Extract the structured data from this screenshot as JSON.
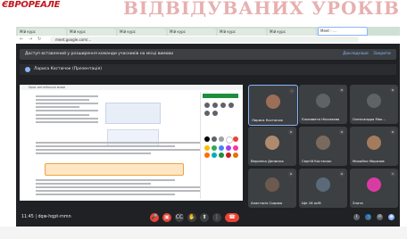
{
  "banner": {
    "logo_text": "ЄВРОРЕАЛЕ",
    "title": "ВІДВІДУВАНИХ УРОКІВ"
  },
  "browser": {
    "tabs": [
      "Мій курс",
      "Мій курс",
      "Мій курс",
      "Мій курс",
      "Мій курс",
      "Мій курс",
      "Meet - ..."
    ],
    "url": "meet.google.com/..."
  },
  "meet": {
    "info_text": "Доступ вставлений у розширення команди учасників на місці вимови",
    "info_links": [
      "Докладніше",
      "Закрити"
    ],
    "presenting_text": "Лариса Костючок (Презентація)",
    "doc_title": "Урок англійської мови",
    "tiles": [
      {
        "name": "Лариса Костючок",
        "color": "#9c6f58",
        "mic": "•"
      },
      {
        "name": "Єлизавета Ніколаєва",
        "color": "#5f6368",
        "mic": "⚙"
      },
      {
        "name": "Олександра Мак...",
        "color": "#5f6368",
        "mic": "⚙"
      },
      {
        "name": "Вероніка Денисюк",
        "color": "#b08a6e",
        "mic": "⚙"
      },
      {
        "name": "Сергій Костючок",
        "color": "#7a6a5e",
        "mic": "⚙"
      },
      {
        "name": "Михайло Морозов",
        "color": "#a47b5e",
        "mic": "⚙"
      },
      {
        "name": "Анастасія Сирова",
        "color": "#6d5a4f",
        "mic": "⚙"
      },
      {
        "name": "Ще 16 осіб",
        "color": "#5a6a7a",
        "mic": "⚙"
      },
      {
        "name": "Злата",
        "color": "#d93ba3",
        "mic": "З"
      }
    ],
    "time": "11:45 | dqw-hqpt-rnmn",
    "palette_colors": [
      "#000000",
      "#5f6368",
      "#9aa0a6",
      "#ffffff",
      "#ea4335",
      "#fbbc04",
      "#34a853",
      "#4285f4",
      "#a142f4",
      "#f538a0",
      "#ff6d00",
      "#00acc1",
      "#1e8e3e",
      "#c5221f",
      "#e37400"
    ]
  }
}
